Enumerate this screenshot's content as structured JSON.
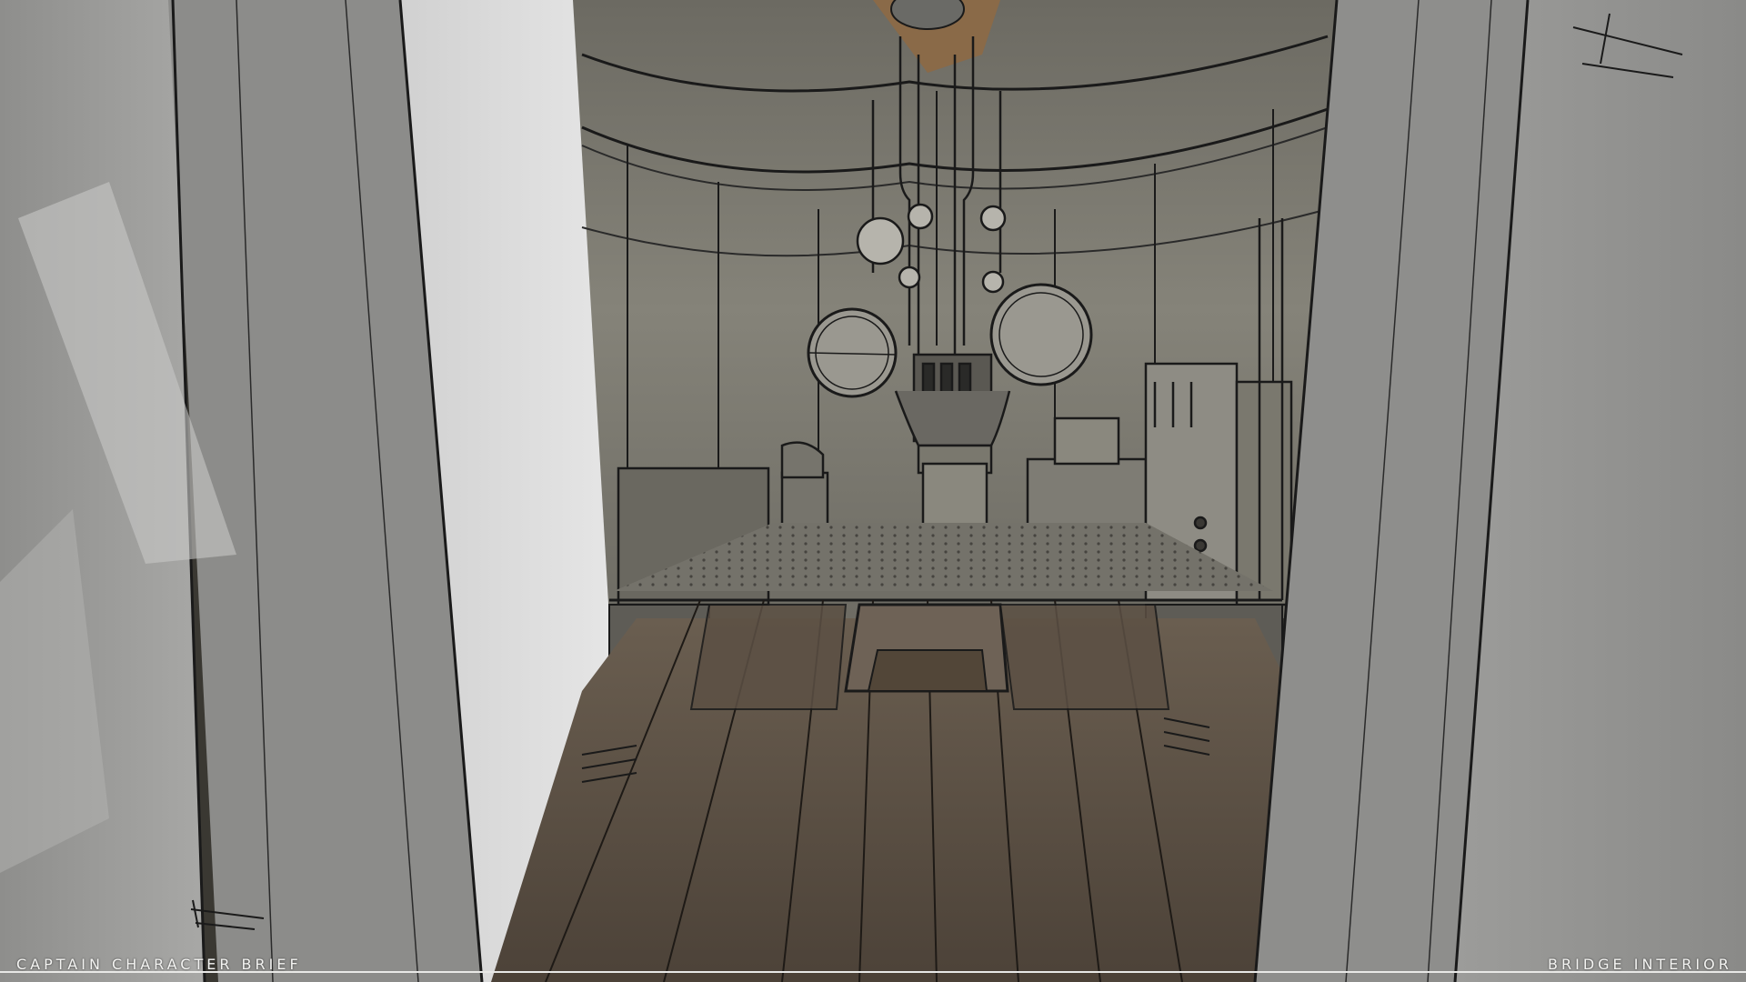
{
  "captions": {
    "left": "CAPTAIN CHARACTER BRIEF",
    "right": "BRIDGE INTERIOR"
  },
  "colors": {
    "wall_gray": "#9a9a98",
    "backdrop": "#d9d9d9",
    "room_gray": "#7c7a72",
    "wood_floor": "#5e5246",
    "ink": "#1a1a1a"
  }
}
